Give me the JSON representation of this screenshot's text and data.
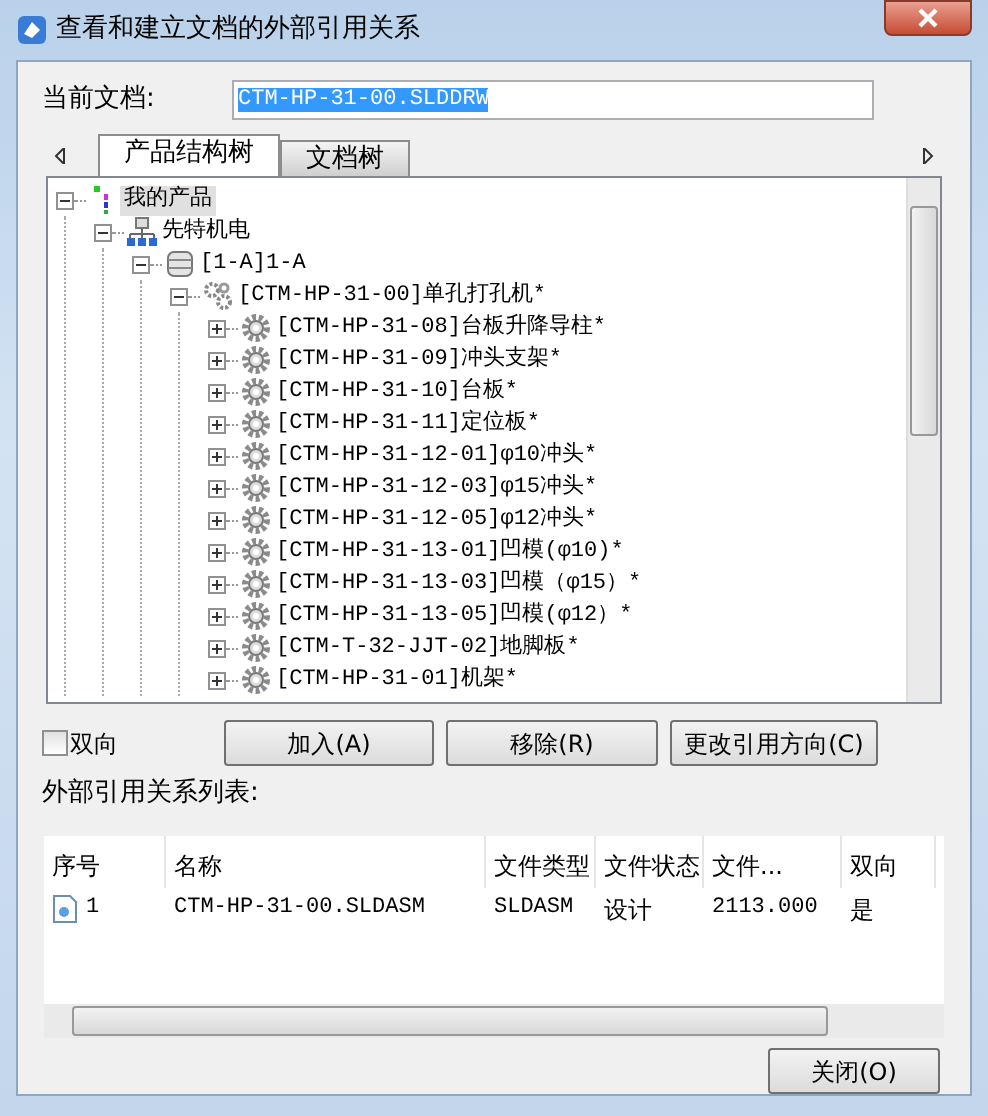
{
  "window": {
    "title": "查看和建立文档的外部引用关系"
  },
  "current_document": {
    "label": "当前文档:",
    "value": "CTM-HP-31-00.SLDDRW",
    "selected": true
  },
  "tabs": [
    {
      "label": "产品结构树",
      "selected": true
    },
    {
      "label": "文档树",
      "selected": false
    }
  ],
  "tree": [
    {
      "kind": "root",
      "label": "我的产品",
      "expanded": true,
      "selected": true,
      "children": [
        {
          "kind": "company",
          "label": "先特机电",
          "expanded": true,
          "selected": false,
          "children": [
            {
              "kind": "database",
              "label": "[1-A]1-A",
              "expanded": true,
              "selected": false,
              "children": [
                {
                  "kind": "assembly",
                  "label": "[CTM-HP-31-00]单孔打孔机*",
                  "expanded": true,
                  "selected": false,
                  "children": [
                    {
                      "kind": "part",
                      "label": "[CTM-HP-31-08]台板升降导柱*",
                      "expanded": false,
                      "selected": false
                    },
                    {
                      "kind": "part",
                      "label": "[CTM-HP-31-09]冲头支架*",
                      "expanded": false,
                      "selected": false
                    },
                    {
                      "kind": "part",
                      "label": "[CTM-HP-31-10]台板*",
                      "expanded": false,
                      "selected": false
                    },
                    {
                      "kind": "part",
                      "label": "[CTM-HP-31-11]定位板*",
                      "expanded": false,
                      "selected": false
                    },
                    {
                      "kind": "part",
                      "label": "[CTM-HP-31-12-01]φ10冲头*",
                      "expanded": false,
                      "selected": false
                    },
                    {
                      "kind": "part",
                      "label": "[CTM-HP-31-12-03]φ15冲头*",
                      "expanded": false,
                      "selected": false
                    },
                    {
                      "kind": "part",
                      "label": "[CTM-HP-31-12-05]φ12冲头*",
                      "expanded": false,
                      "selected": false
                    },
                    {
                      "kind": "part",
                      "label": "[CTM-HP-31-13-01]凹模(φ10)*",
                      "expanded": false,
                      "selected": false
                    },
                    {
                      "kind": "part",
                      "label": "[CTM-HP-31-13-03]凹模（φ15）*",
                      "expanded": false,
                      "selected": false
                    },
                    {
                      "kind": "part",
                      "label": "[CTM-HP-31-13-05]凹模(φ12）*",
                      "expanded": false,
                      "selected": false
                    },
                    {
                      "kind": "part",
                      "label": "[CTM-T-32-JJT-02]地脚板*",
                      "expanded": false,
                      "selected": false
                    },
                    {
                      "kind": "part",
                      "label": "[CTM-HP-31-01]机架*",
                      "expanded": false,
                      "selected": false
                    }
                  ]
                }
              ]
            }
          ]
        }
      ]
    }
  ],
  "bidirectional_checkbox": {
    "label": "双向",
    "checked": false
  },
  "buttons": [
    "加入(A)",
    "移除(R)",
    "更改引用方向(C)"
  ],
  "references": {
    "title": "外部引用关系列表:",
    "columns": [
      "序号",
      "名称",
      "文件类型",
      "文件状态",
      "文件...",
      "双向"
    ],
    "rows": [
      {
        "cells": [
          "1",
          "CTM-HP-31-00.SLDASM",
          "SLDASM",
          "设计",
          "2113.000",
          "是"
        ]
      }
    ]
  },
  "close_button": "关闭(O)"
}
